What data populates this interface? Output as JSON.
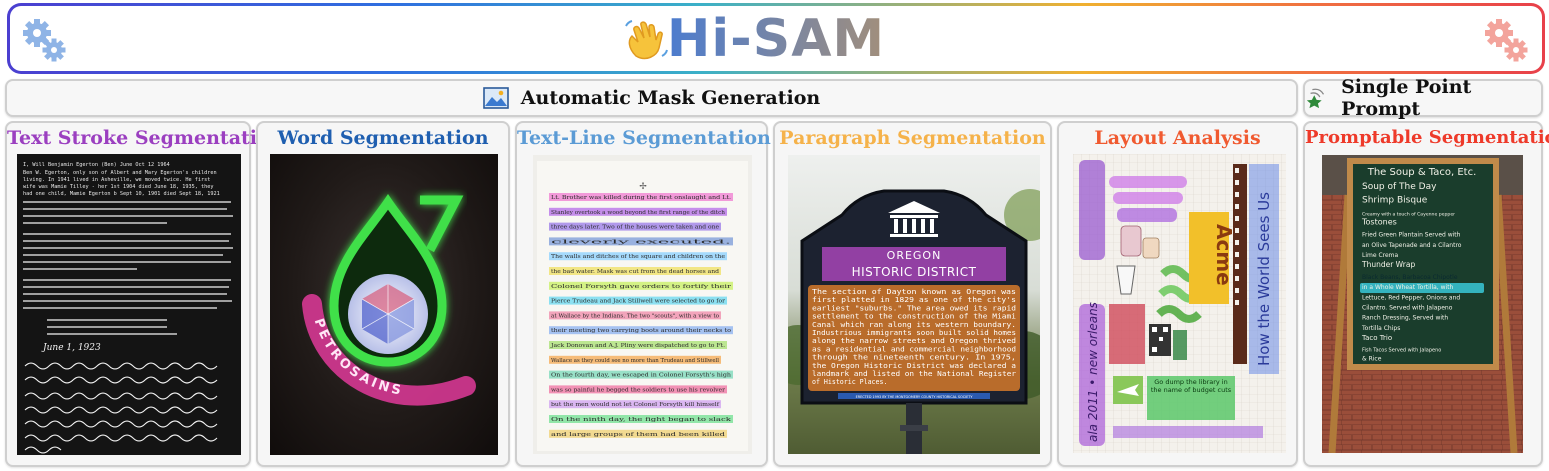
{
  "banner": {
    "title": "Hi-SAM",
    "icons": [
      "gear-icon",
      "waving-hand-icon",
      "gear-icon"
    ],
    "gradient": [
      "#4b3fd0",
      "#3bb0c8",
      "#f0b030",
      "#e8404a"
    ]
  },
  "headers": {
    "amg": {
      "label": "Automatic Mask Generation",
      "icon": "image-icon"
    },
    "spp": {
      "label": "Single Point Prompt",
      "icon": "pointer-star-icon"
    }
  },
  "panels": [
    {
      "title": "Text Stroke Segmentation",
      "color": "#9b3fc0"
    },
    {
      "title": "Word Segmentation",
      "color": "#1f5fb0"
    },
    {
      "title": "Text-Line Segmentation",
      "color": "#5b9bd5"
    },
    {
      "title": "Paragraph Segmentation",
      "color": "#f5b24a"
    },
    {
      "title": "Layout Analysis",
      "color": "#f05a30"
    },
    {
      "title": "Promptable Segmentation",
      "color": "#ee3a2a"
    }
  ],
  "images": {
    "text_stroke": {
      "date": "June 1, 1923",
      "letter_lines": [
        "I, Will Benjamin Egerton (Ben) June Oct 12 1964",
        "Ben W. Egerton, only son of Albert and Mary Egerton's children",
        "living. In 1941 lived in Asheville, we moved twice. He first",
        "wife was Mamie Tilley - her 1st 1904 died June 18, 1935, they",
        "had one child, Mamie Egerton b Sept 10, 1901 died Sept 18, 1921"
      ]
    },
    "word": {
      "logo_text": "PETROSAINS"
    },
    "textline": {
      "lines": [
        "Lt. Brother was killed during the first onslaught and Lt.",
        "Stanley overtook a wood beyond the first range of the ditch",
        "three days later. Two of the houses were taken and one",
        "cleverly executed.",
        "The walls and ditches of the square and children on the",
        "the bad water. Mask was cut from the dead horses and",
        "Colonel Forsyth gave orders to fortify their",
        "Pierce Trudeau and Jack Stillwell were selected to go for",
        "at Wallace by the Indians. The two \"scouts\", with a view to",
        "their meeting two carrying boots around their necks to",
        "Jack Donovan and A.J. Pliny were dispatched to go to Ft.",
        "Wallace as they could see no more than Trudeau and Stillwell",
        "On the fourth day, we escaped in Colonel Forsyth's high",
        "was so painful he begged the soldiers to use his revolver",
        "but the men would not let Colonel Forsyth kill himself",
        "On the ninth day, the fight began to slack",
        "and large groups of them had been killed"
      ]
    },
    "paragraph": {
      "sign_title_1": "OREGON",
      "sign_title_2": "HISTORIC DISTRICT",
      "sign_lines": [
        "The section of Dayton known as Oregon was",
        "first platted in 1829 as one of the city's",
        "earliest \"suburbs.\" The area owed its rapid",
        "settlement to the construction of the Miami",
        "Canal which ran along its western boundary.",
        "Industrious immigrants soon built solid homes",
        "along the narrow streets and Oregon thrived",
        "as a residential and commercial neighborhood",
        "through the nineteenth century. In 1975,",
        "the Oregon Historic District was declared a",
        "landmark and listed on the National Register",
        "of Historic Places."
      ],
      "sign_footer": "ERECTED 1993 BY THE MONTGOMERY COUNTY HISTORICAL SOCIETY"
    },
    "layout": {
      "vertical_text": "How the World Sees Us",
      "acme": "Acme",
      "side_text": "ala 2011 • new orleans",
      "small_note": "Go dump the library in the name of budget cuts"
    },
    "prompt": {
      "board_lines": [
        "The Soup & Taco, Etc.",
        "Soup of The Day",
        "Shrimp Bisque",
        "Creamy with a touch of Cayenne pepper",
        "Tostones",
        "Fried Green Plantain Served with",
        "an Olive Tapenade and a Cilantro",
        "Lime Crema",
        "Thunder Wrap",
        "Black Beans, Barbacoa Chipotle",
        "in a Whole Wheat Tortilla, with",
        "Lettuce, Red Pepper, Onions and",
        "Cilantro. Served with Jalapeno",
        "Ranch Dressing, Served with",
        "Tortilla Chips",
        "Taco Trio",
        "Fish Tacos Served with Jalapeno",
        "& Rice"
      ]
    }
  }
}
